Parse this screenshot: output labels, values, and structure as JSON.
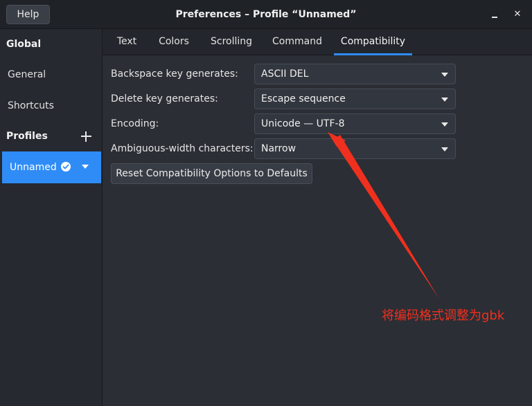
{
  "window": {
    "title": "Preferences – Profile “Unnamed”",
    "help_label": "Help",
    "close_glyph": "✕"
  },
  "sidebar": {
    "global_header": "Global",
    "general_label": "General",
    "shortcuts_label": "Shortcuts",
    "profiles_header": "Profiles",
    "profile_name": "Unnamed"
  },
  "tabs": [
    "Text",
    "Colors",
    "Scrolling",
    "Command",
    "Compatibility"
  ],
  "active_tab": "Compatibility",
  "settings": {
    "backspace": {
      "label": "Backspace key generates:",
      "value": "ASCII DEL"
    },
    "delete": {
      "label": "Delete key generates:",
      "value": "Escape sequence"
    },
    "encoding": {
      "label": "Encoding:",
      "value": "Unicode — UTF-8"
    },
    "ambiguous": {
      "label": "Ambiguous-width characters:",
      "value": "Narrow"
    },
    "reset_label": "Reset Compatibility Options to Defaults"
  },
  "annotation": {
    "text": "将编码格式调整为gbk",
    "color": "#f0301e"
  },
  "colors": {
    "accent": "#2f8cf6",
    "background": "#2b2e35"
  }
}
